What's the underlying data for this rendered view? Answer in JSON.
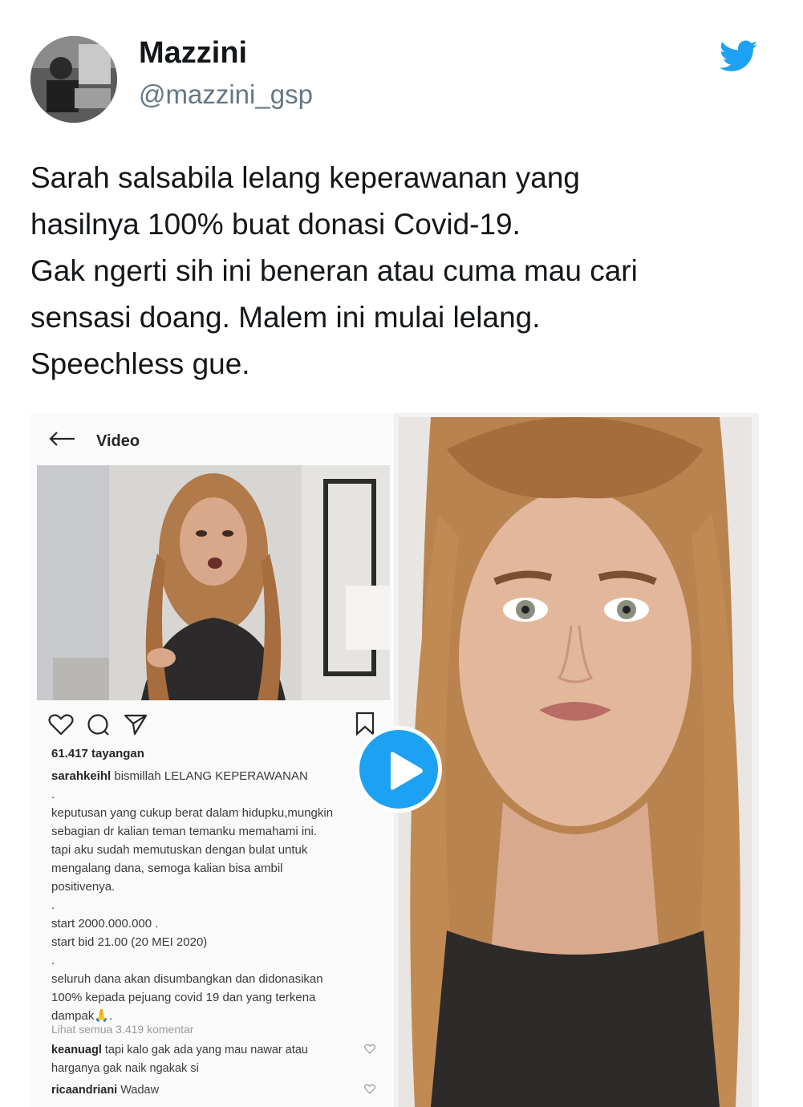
{
  "tweet": {
    "author_name": "Mazzini",
    "author_handle": "@mazzini_gsp",
    "text_lines": [
      "Sarah salsabila lelang keperawanan yang",
      "hasilnya 100% buat donasi Covid-19.",
      "Gak ngerti sih ini beneran atau cuma mau cari",
      "sensasi doang. Malem ini mulai lelang.",
      "Speechless gue."
    ],
    "brand_icon": "twitter-bird-icon",
    "brand_color": "#1da1f2"
  },
  "media": {
    "play_icon": "play-icon",
    "instagram": {
      "title": "Video",
      "views": "61.417 tayangan",
      "caption_user": "sarahkeihl",
      "caption_first": " bismillah LELANG KEPERAWANAN",
      "caption_lines": [
        ".",
        "keputusan yang cukup berat dalam hidupku,mungkin",
        "sebagian dr kalian teman temanku memahami ini.",
        "tapi aku sudah memutuskan dengan bulat untuk",
        "mengalang dana, semoga kalian bisa ambil",
        "positivenya.",
        ".",
        "start 2000.000.000 .",
        "start bid 21.00 (20 MEI 2020)",
        ".",
        "seluruh dana akan disumbangkan dan didonasikan",
        "100% kepada pejuang covid 19 dan yang terkena",
        "dampak🙏."
      ],
      "comments_link": "Lihat semua 3.419 komentar",
      "comments": [
        {
          "user": "keanuagl",
          "text": " tapi kalo gak ada yang mau nawar atau",
          "text2": "harganya gak naik ngakak si"
        },
        {
          "user": "ricaandriani",
          "text": " Wadaw",
          "text2": ""
        }
      ]
    }
  }
}
